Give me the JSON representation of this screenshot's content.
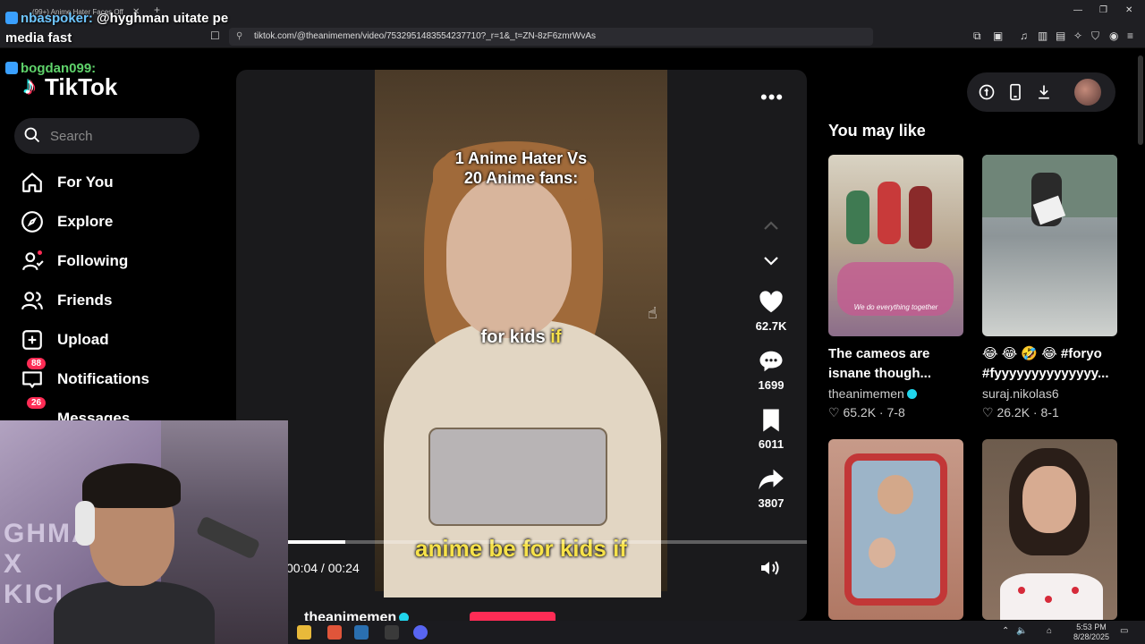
{
  "browser": {
    "tab_title": "(99+) Anime Hater Faces Off",
    "url": "tiktok.com/@theanimemen/video/7532951483554237710?_r=1&_t=ZN-8zF6zmrWvAs"
  },
  "overlay_chat": {
    "msg1_user": "nbaspoker:",
    "msg1_text": "@hyghman uitate pe",
    "msg1_text2": "media fast",
    "msg2_user": "bogdan099:"
  },
  "sidebar": {
    "logo": "TikTok",
    "search_placeholder": "Search",
    "items": [
      {
        "label": "For You"
      },
      {
        "label": "Explore"
      },
      {
        "label": "Following"
      },
      {
        "label": "Friends"
      },
      {
        "label": "Upload"
      },
      {
        "label": "Notifications",
        "badge": "88"
      },
      {
        "label": "Messages",
        "badge": "26"
      }
    ]
  },
  "webcam": {
    "bg_text1": "GHMA",
    "bg_text2": "X",
    "bg_text3": "KICI"
  },
  "video": {
    "title_line1": "1 Anime Hater  Vs",
    "title_line2": "20 Anime fans:",
    "caption_prefix": "for kids ",
    "caption_highlight": "if",
    "subtitle": "anime be for kids if",
    "time": "00:04 / 00:24",
    "progress": 0.11,
    "author": "theanimemen",
    "likes": "62.7K",
    "comments": "1699",
    "saves": "6011",
    "shares": "3807"
  },
  "recommendations": {
    "title": "You may like",
    "cards": [
      {
        "caption": "The cameos are isnane though...",
        "author": "theanimemen",
        "verified": true,
        "likes": "65.2K",
        "date": "7-8",
        "overlay": "We do everything together"
      },
      {
        "caption": "😂 😂 🤣 😂 #foryo #fyyyyyyyyyyyyyy...",
        "author": "suraj.nikolas6",
        "verified": false,
        "likes": "26.2K",
        "date": "8-1"
      },
      {
        "caption": "",
        "author": "",
        "likes": "",
        "date": ""
      },
      {
        "caption": "",
        "author": "",
        "likes": "",
        "date": ""
      }
    ]
  },
  "taskbar": {
    "time": "5:53 PM",
    "date": "8/28/2025"
  },
  "colors": {
    "accent": "#fe2c55",
    "caption_yellow": "#f7e24a",
    "verified": "#20d5ec"
  }
}
